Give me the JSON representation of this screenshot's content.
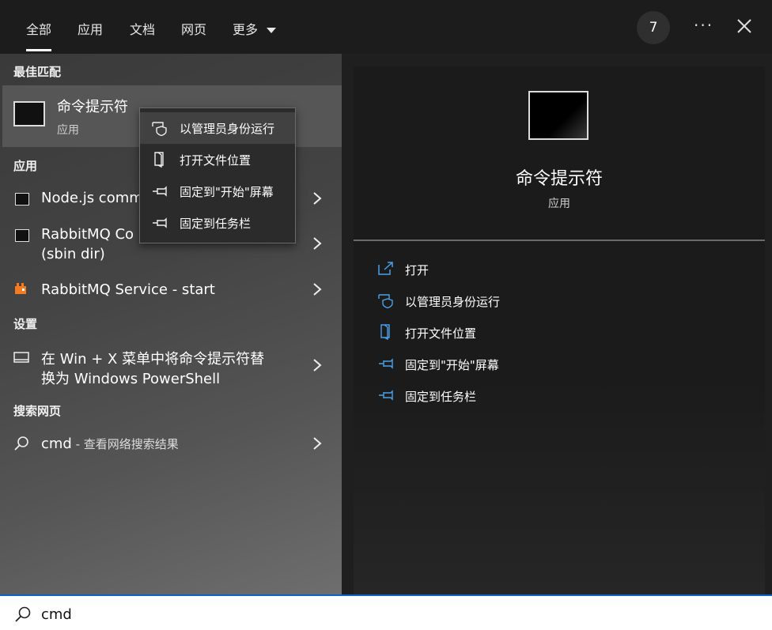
{
  "tabs": [
    "全部",
    "应用",
    "文档",
    "网页",
    "更多"
  ],
  "badge_count": "7",
  "sections": {
    "best_match": "最佳匹配",
    "apps": "应用",
    "settings": "设置",
    "web": "搜索网页"
  },
  "best_match_item": {
    "title": "命令提示符",
    "sub": "应用"
  },
  "apps": [
    {
      "label": "Node.js comm"
    },
    {
      "label": "RabbitMQ Co",
      "label2": "(sbin dir)"
    },
    {
      "label": "RabbitMQ Service - start"
    }
  ],
  "setting_item": {
    "line1": "在 Win + X 菜单中将命令提示符替",
    "line2": "换为 Windows PowerShell"
  },
  "web_item": {
    "query": "cmd",
    "suffix": " - 查看网络搜索结果"
  },
  "context_menu": [
    "以管理员身份运行",
    "打开文件位置",
    "固定到\"开始\"屏幕",
    "固定到任务栏"
  ],
  "preview": {
    "title": "命令提示符",
    "sub": "应用"
  },
  "actions": [
    "打开",
    "以管理员身份运行",
    "打开文件位置",
    "固定到\"开始\"屏幕",
    "固定到任务栏"
  ],
  "search": {
    "value": "cmd"
  },
  "colors": {
    "accent": "#4aa0e8",
    "rabbit": "#f47b20",
    "searchbar_border": "#0a64c8"
  }
}
